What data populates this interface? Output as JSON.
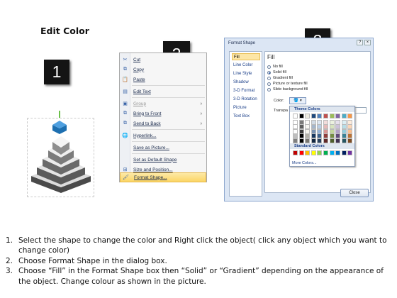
{
  "slide": {
    "title": "Edit Color",
    "badges": [
      "1",
      "2",
      "3"
    ]
  },
  "context_menu": {
    "items": [
      {
        "label": "Cut",
        "icon": "scissors-icon",
        "enabled": true
      },
      {
        "label": "Copy",
        "icon": "copy-icon",
        "enabled": true
      },
      {
        "label": "Paste",
        "icon": "paste-icon",
        "enabled": true
      },
      {
        "label": "Edit Text",
        "icon": "edit-text-icon",
        "enabled": true
      },
      {
        "label": "Group",
        "icon": "group-icon",
        "enabled": false,
        "submenu": true
      },
      {
        "label": "Bring to Front",
        "icon": "bring-front-icon",
        "enabled": true,
        "submenu": true
      },
      {
        "label": "Send to Back",
        "icon": "send-back-icon",
        "enabled": true,
        "submenu": true
      },
      {
        "label": "Hyperlink...",
        "icon": "hyperlink-icon",
        "enabled": true
      },
      {
        "label": "Save as Picture...",
        "icon": "",
        "enabled": true
      },
      {
        "label": "Set as Default Shape",
        "icon": "",
        "enabled": true
      },
      {
        "label": "Size and Position...",
        "icon": "size-icon",
        "enabled": true
      },
      {
        "label": "Format Shape...",
        "icon": "format-shape-icon",
        "enabled": true,
        "highlighted": true
      }
    ]
  },
  "dialog": {
    "title": "Format Shape",
    "categories": [
      "Fill",
      "Line Color",
      "Line Style",
      "Shadow",
      "3-D Format",
      "3-D Rotation",
      "Picture",
      "Text Box"
    ],
    "selected_category": "Fill",
    "pane_heading": "Fill",
    "fill_options": [
      "No fill",
      "Solid fill",
      "Gradient fill",
      "Picture or texture fill",
      "Slide background fill"
    ],
    "selected_fill": "Solid fill",
    "color_label": "Color:",
    "transparency_label": "Transpa",
    "transparency_value": "",
    "theme_colors_label": "Theme Colors",
    "standard_colors_label": "Standard Colors",
    "more_colors_label": "More Colors...",
    "close_label": "Close",
    "theme_columns": [
      "#ffffff",
      "#000000",
      "#eeece1",
      "#1f497d",
      "#4f81bd",
      "#c0504d",
      "#9bbb59",
      "#8064a2",
      "#4bacc6",
      "#f79646"
    ],
    "standard_colors": [
      "#c00000",
      "#ff0000",
      "#ffc000",
      "#ffff00",
      "#92d050",
      "#00b050",
      "#00b0f0",
      "#0070c0",
      "#002060",
      "#7030a0"
    ]
  },
  "instructions": [
    {
      "num": "1.",
      "text": "Select the shape to change the color and Right click the object( click any object which you want to change color)"
    },
    {
      "num": "2.",
      "text": "Choose Format Shape in the dialog box."
    },
    {
      "num": "3.",
      "text": "Choose “Fill” in the Format Shape box then “Solid” or “Gradient” depending on the appearance of the object. Change colour as shown in the picture."
    }
  ]
}
